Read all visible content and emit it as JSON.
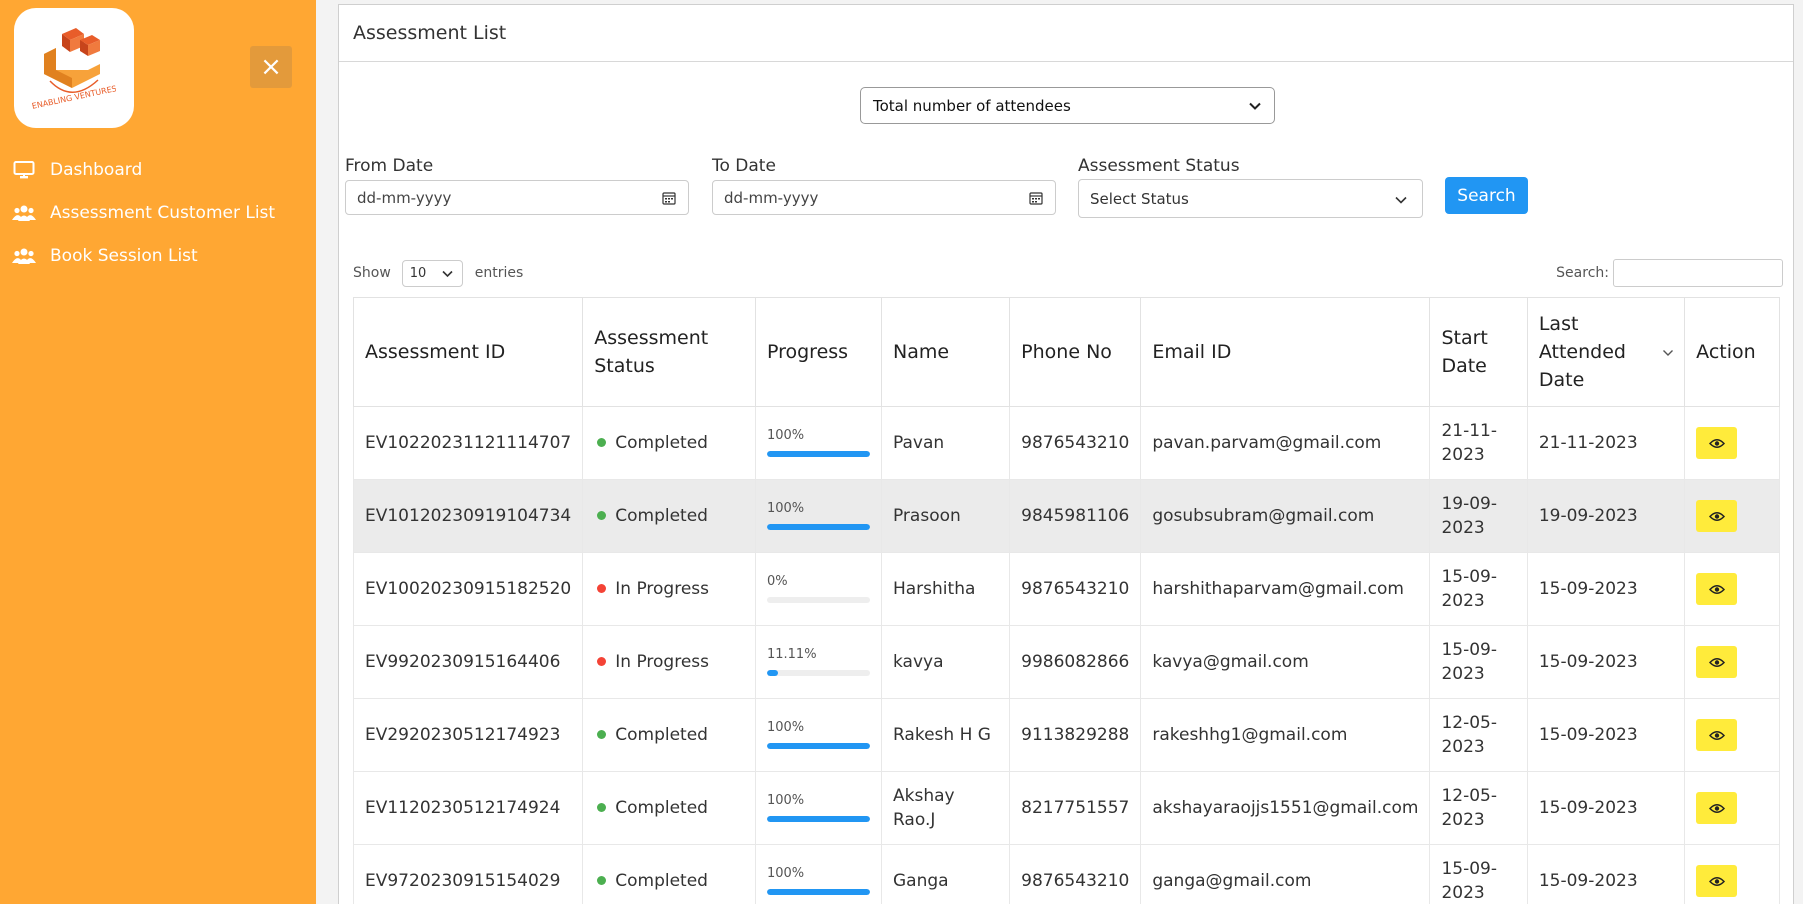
{
  "sidebar": {
    "logo_text": "ENABLING VENTURES",
    "close_label": "×",
    "items": [
      {
        "label": "Dashboard",
        "icon": "monitor-icon"
      },
      {
        "label": "Assessment Customer List",
        "icon": "users-icon"
      },
      {
        "label": "Book Session List",
        "icon": "users-icon"
      }
    ]
  },
  "panel": {
    "title": "Assessment List",
    "report_select": "Total number of attendees",
    "filters": {
      "from_label": "From Date",
      "from_placeholder": "dd-mm-yyyy",
      "to_label": "To Date",
      "to_placeholder": "dd-mm-yyyy",
      "status_label": "Assessment Status",
      "status_value": "Select Status",
      "search_label": "Search"
    },
    "datatable": {
      "show_label": "Show",
      "page_length": "10",
      "entries_label": "entries",
      "search_label": "Search:"
    },
    "columns": [
      "Assessment ID",
      "Assessment Status",
      "Progress",
      "Name",
      "Phone No",
      "Email ID",
      "Start Date",
      "Last Attended Date",
      "Action"
    ],
    "rows": [
      {
        "id": "EV10220231121114707",
        "status": "Completed",
        "progress": "100%",
        "progress_value": 100,
        "name": "Pavan",
        "phone": "9876543210",
        "email": "pavan.parvam@gmail.com",
        "start": "21-11-2023",
        "last": "21-11-2023"
      },
      {
        "id": "EV10120230919104734",
        "status": "Completed",
        "progress": "100%",
        "progress_value": 100,
        "name": "Prasoon",
        "phone": "9845981106",
        "email": "gosubsubram@gmail.com",
        "start": "19-09-2023",
        "last": "19-09-2023"
      },
      {
        "id": "EV10020230915182520",
        "status": "In Progress",
        "progress": "0%",
        "progress_value": 0,
        "name": "Harshitha",
        "phone": "9876543210",
        "email": "harshithaparvam@gmail.com",
        "start": "15-09-2023",
        "last": "15-09-2023"
      },
      {
        "id": "EV9920230915164406",
        "status": "In Progress",
        "progress": "11.11%",
        "progress_value": 11.11,
        "name": "kavya",
        "phone": "9986082866",
        "email": "kavya@gmail.com",
        "start": "15-09-2023",
        "last": "15-09-2023"
      },
      {
        "id": "EV2920230512174923",
        "status": "Completed",
        "progress": "100%",
        "progress_value": 100,
        "name": "Rakesh H G",
        "phone": "9113829288",
        "email": "rakeshhg1@gmail.com",
        "start": "12-05-2023",
        "last": "15-09-2023"
      },
      {
        "id": "EV1120230512174924",
        "status": "Completed",
        "progress": "100%",
        "progress_value": 100,
        "name": "Akshay Rao.J",
        "phone": "8217751557",
        "email": "akshayaraojjs1551@gmail.com",
        "start": "12-05-2023",
        "last": "15-09-2023"
      },
      {
        "id": "EV9720230915154029",
        "status": "Completed",
        "progress": "100%",
        "progress_value": 100,
        "name": "Ganga",
        "phone": "9876543210",
        "email": "ganga@gmail.com",
        "start": "15-09-2023",
        "last": "15-09-2023"
      }
    ]
  },
  "colors": {
    "sidebar_bg": "#ffa733",
    "primary": "#2196f3",
    "completed": "#4caf50",
    "in_progress": "#f44336",
    "action_btn": "#ffeb3b"
  }
}
